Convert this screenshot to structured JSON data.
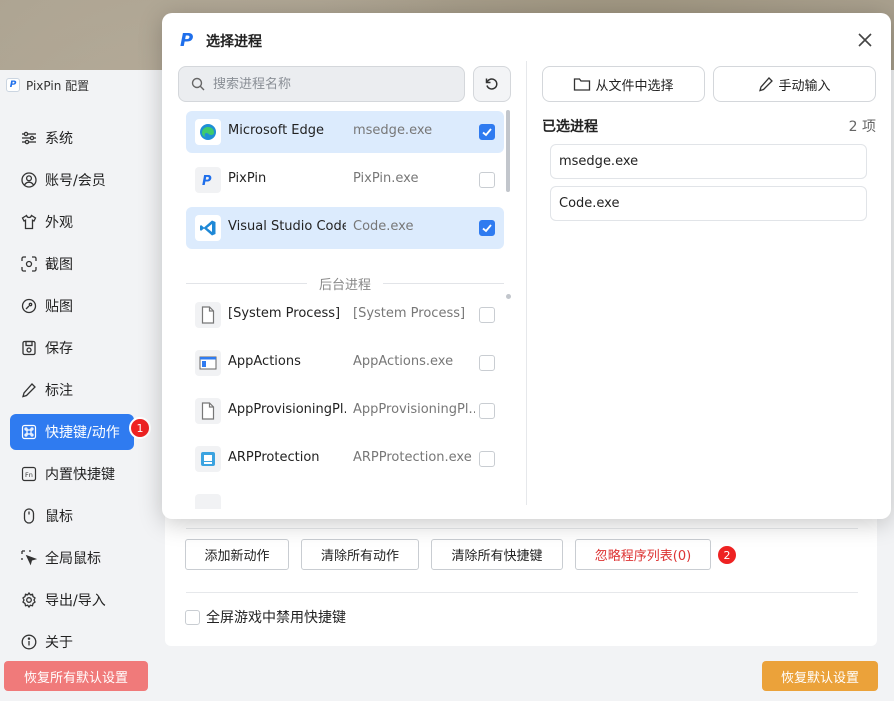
{
  "app": {
    "title": "PixPin 配置",
    "logo_letter": "P"
  },
  "sidebar": {
    "items": [
      {
        "label": "系统",
        "icon": "sliders-icon"
      },
      {
        "label": "账号/会员",
        "icon": "user-icon"
      },
      {
        "label": "外观",
        "icon": "shirt-icon"
      },
      {
        "label": "截图",
        "icon": "screenshot-icon"
      },
      {
        "label": "贴图",
        "icon": "pin-icon"
      },
      {
        "label": "保存",
        "icon": "save-icon"
      },
      {
        "label": "标注",
        "icon": "pen-icon"
      },
      {
        "label": "快捷键/动作",
        "icon": "command-icon",
        "active": true,
        "badge": "1"
      },
      {
        "label": "内置快捷键",
        "icon": "fn-key-icon"
      },
      {
        "label": "鼠标",
        "icon": "mouse-icon"
      },
      {
        "label": "全局鼠标",
        "icon": "cursor-icon"
      },
      {
        "label": "导出/导入",
        "icon": "gear-icon"
      },
      {
        "label": "关于",
        "icon": "info-icon"
      }
    ],
    "restore_all_label": "恢复所有默认设置"
  },
  "main": {
    "buttons": {
      "add_action": "添加新动作",
      "clear_actions": "清除所有动作",
      "clear_hotkeys": "清除所有快捷键",
      "ignore_list": "忽略程序列表(0)",
      "ignore_badge": "2"
    },
    "fullscreen_checkbox_label": "全屏游戏中禁用快捷键",
    "restore_default_label": "恢复默认设置"
  },
  "modal": {
    "title": "选择进程",
    "search_placeholder": "搜索进程名称",
    "from_file_label": "从文件中选择",
    "manual_input_label": "手动输入",
    "background_section_label": "后台进程",
    "foreground_processes": [
      {
        "name": "Microsoft Edge",
        "exe": "msedge.exe",
        "checked": true,
        "icon": "edge-icon"
      },
      {
        "name": "PixPin",
        "exe": "PixPin.exe",
        "checked": false,
        "icon": "pixpin-icon"
      },
      {
        "name": "Visual Studio Code",
        "exe": "Code.exe",
        "checked": true,
        "icon": "vscode-icon"
      }
    ],
    "background_processes": [
      {
        "name": "[System Process]",
        "exe": "[System Process]",
        "checked": false,
        "icon": "file-icon"
      },
      {
        "name": "AppActions",
        "exe": "AppActions.exe",
        "checked": false,
        "icon": "app-window-icon"
      },
      {
        "name": "AppProvisioningPl...",
        "exe": "AppProvisioningPl...",
        "checked": false,
        "icon": "file-icon"
      },
      {
        "name": "ARPProtection",
        "exe": "ARPProtection.exe",
        "checked": false,
        "icon": "arp-icon"
      }
    ],
    "selected_title": "已选进程",
    "selected_count": "2 项",
    "selected_items": [
      "msedge.exe",
      "Code.exe"
    ]
  },
  "colors": {
    "accent": "#2f7bf0",
    "danger": "#f07a7a",
    "warning": "#eba23a",
    "badge": "#ee2222"
  }
}
